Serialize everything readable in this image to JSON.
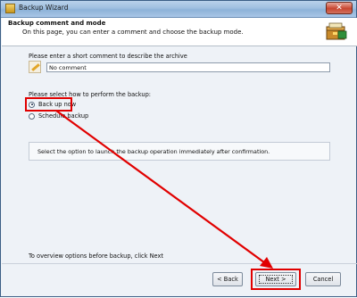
{
  "window": {
    "title": "Backup Wizard",
    "close_glyph": "✕"
  },
  "header": {
    "title": "Backup comment and mode",
    "subtitle": "On this page, you can enter a comment and choose the backup mode."
  },
  "comment": {
    "label": "Please enter a short comment to describe the archive",
    "value": "No comment"
  },
  "mode": {
    "label": "Please select how to perform the backup:",
    "options": [
      {
        "label": "Back up now",
        "selected": true
      },
      {
        "label": "Schedule backup",
        "selected": false
      }
    ],
    "info": "Select the option to launch the backup operation immediately after confirmation."
  },
  "footer": {
    "hint": "To overview options before backup, click Next",
    "back_label": "< Back",
    "next_label": "Next >",
    "cancel_label": "Cancel"
  },
  "colors": {
    "annotation": "#e10000",
    "title_gradient_top": "#b9d1ea"
  },
  "icons": {
    "app": "backup-app-icon",
    "header": "archive-box-icon",
    "comment": "pencil-note-icon"
  }
}
